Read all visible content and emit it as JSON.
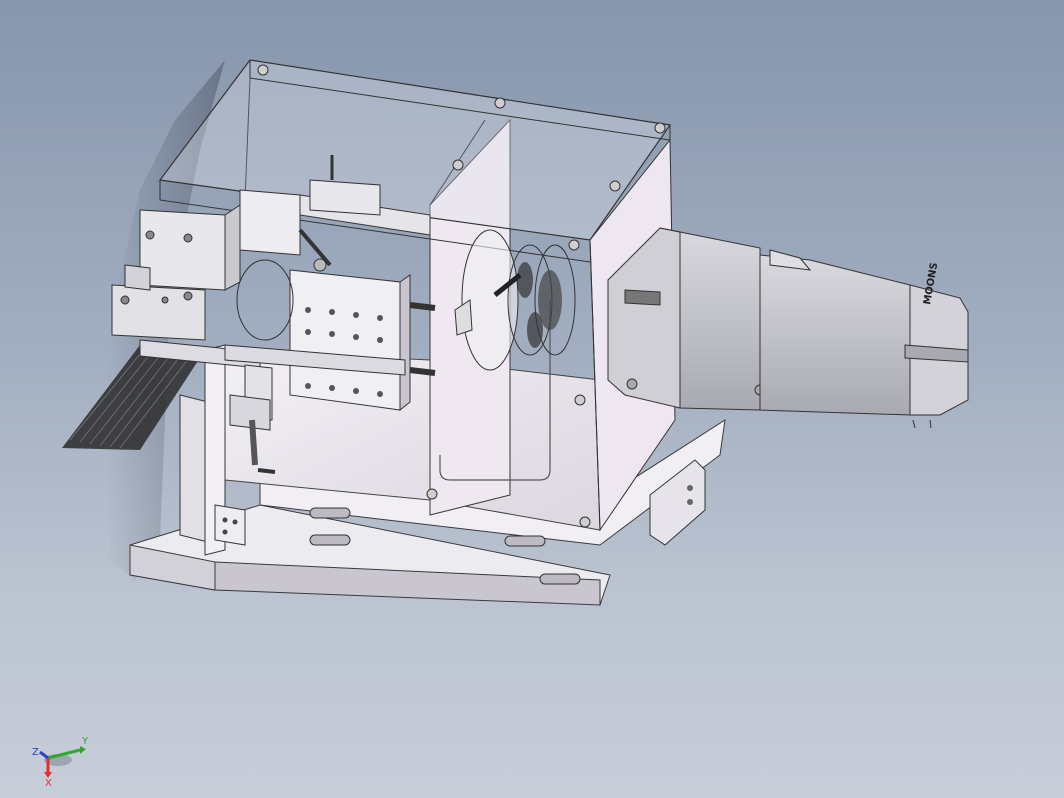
{
  "viewport": {
    "background_top": "#8796ad",
    "background_bottom": "#c7ced9"
  },
  "model": {
    "motor_label": "MOONS",
    "frame_color": "#e8e2ee",
    "panel_color": "#f1edf3",
    "part_color": "#d6d6dc",
    "motor_color": "#c9c9d0"
  },
  "triad": {
    "x_label": "X",
    "y_label": "Y",
    "z_label": "Z",
    "x_color": "#e0302a",
    "y_color": "#2fa82c",
    "z_color": "#2c46c8"
  }
}
